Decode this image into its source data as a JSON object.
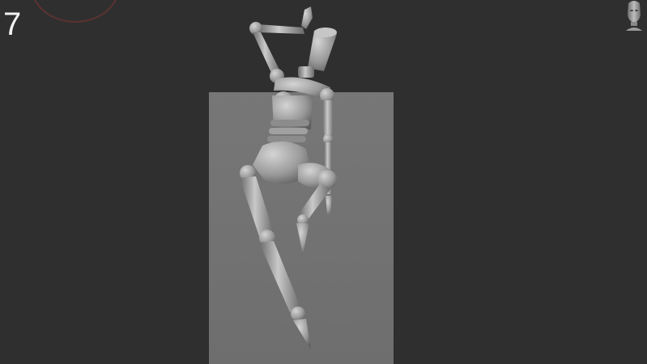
{
  "viewport": {
    "step_number": "7"
  },
  "icons": {
    "navigation_thumbnail": "head-icon",
    "rotation_gizmo": "ring-icon"
  },
  "colors": {
    "background": "#2f2f2f",
    "floor": "#737373",
    "mannequin": "#9a9a9a",
    "gizmo_ring": "#5b3232",
    "step_text": "#f2f2f2"
  }
}
